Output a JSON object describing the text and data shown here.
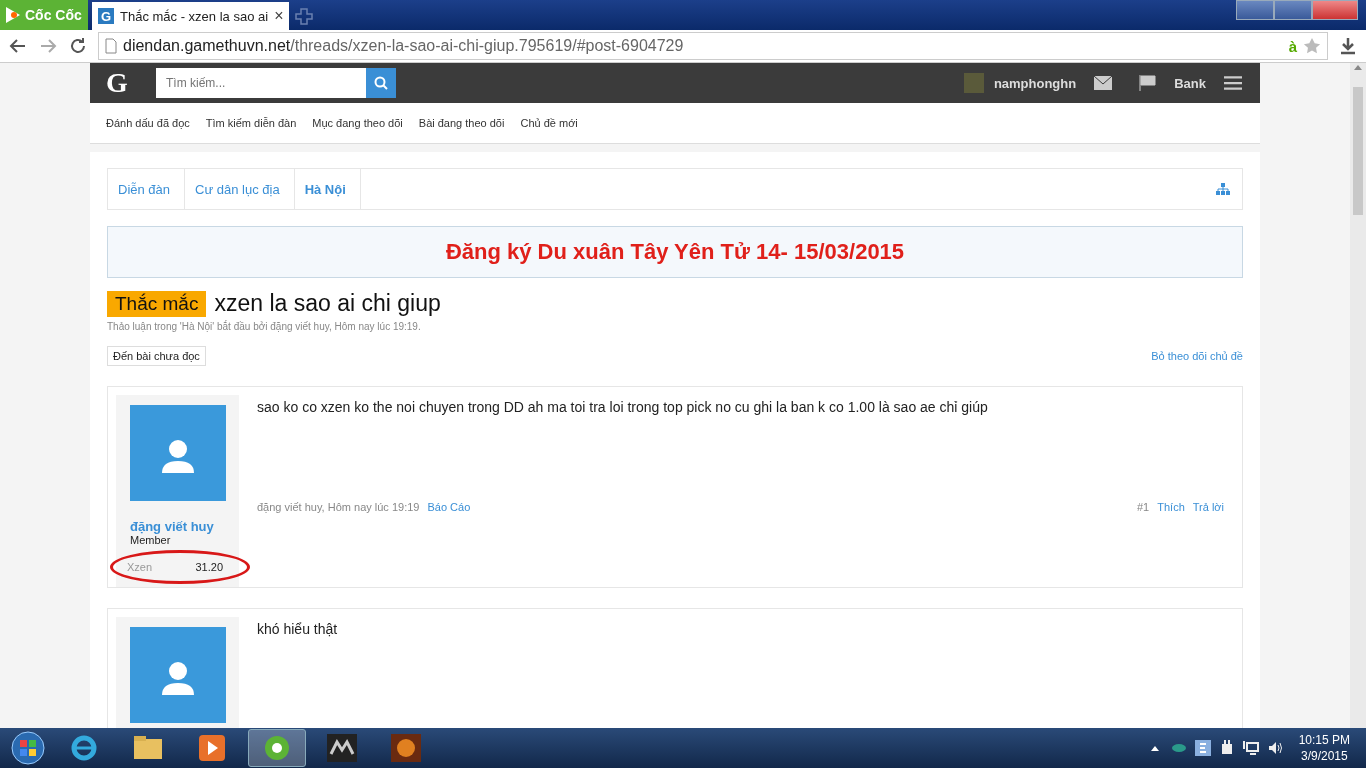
{
  "browser": {
    "brand": "Cốc Cốc",
    "tabs": [
      {
        "title": "Thắc mắc - xzen la sao ai",
        "close": "×",
        "selected": true
      }
    ],
    "favicon": "G",
    "url_host": "diendan.gamethuvn.net",
    "url_path": "/threads/xzen-la-sao-ai-chi-giup.795619/#post-6904729",
    "addon": "à"
  },
  "header": {
    "logo": "G",
    "search_placeholder": "Tìm kiếm...",
    "username": "namphonghn",
    "bank": "Bank"
  },
  "subnav": [
    "Đánh dấu đã đọc",
    "Tìm kiếm diễn đàn",
    "Mục đang theo dõi",
    "Bài đang theo dõi",
    "Chủ đề mới"
  ],
  "breadcrumb": [
    {
      "label": "Diễn đàn",
      "selected": false
    },
    {
      "label": "Cư dân lục địa",
      "selected": false
    },
    {
      "label": "Hà Nội",
      "selected": true
    }
  ],
  "notice": "Đăng ký Du xuân Tây Yên Tử 14- 15/03/2015",
  "thread": {
    "prefix": "Thắc mắc",
    "title": "xzen la sao ai chi giup",
    "description": "Thảo luận trong 'Hà Nội' bắt đầu bởi đặng viết huy, Hôm nay lúc 19:19.",
    "unread_button": "Đến bài chưa đọc",
    "unwatch": "Bỏ theo dõi chủ đề"
  },
  "posts": [
    {
      "username": "đặng viết huy",
      "role": "Member",
      "stat_label": "Xzen",
      "stat_value": "31.20",
      "circled": true,
      "message": "sao ko co xzen ko the noi chuyen trong DD ah ma toi tra loi trong top pick no cu ghi la ban k co 1.00 là sao ae chỉ giúp",
      "author": "đặng viết huy, Hôm nay lúc 19:19",
      "report": "Báo Cáo",
      "number": "#1",
      "like": "Thích",
      "reply": "Trả lời"
    },
    {
      "message": "khó hiểu thật"
    }
  ],
  "taskbar": {
    "time": "10:15 PM",
    "date": "3/9/2015"
  }
}
